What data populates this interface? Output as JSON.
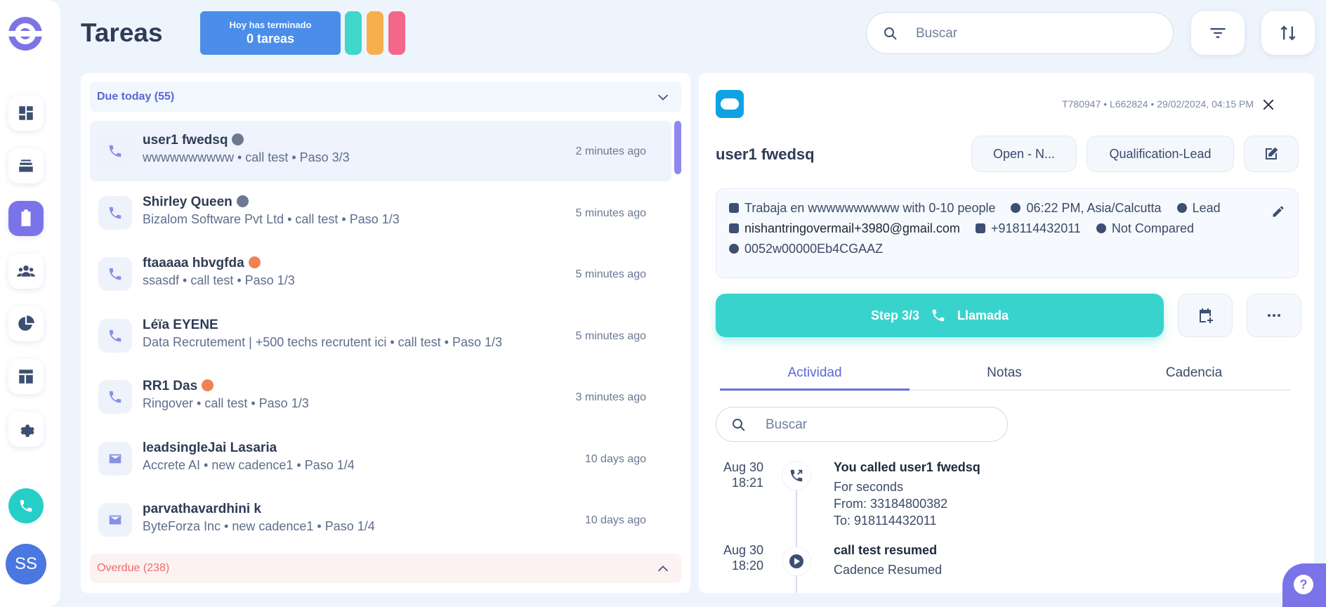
{
  "header": {
    "title": "Tareas",
    "done_line1": "Hoy has terminado",
    "done_line2": "0 tareas",
    "search_placeholder": "Buscar",
    "pills": [
      "#3ed7c9",
      "#f7ae4c",
      "#f4678a"
    ]
  },
  "sidebar": {
    "items": [
      "dashboard-icon",
      "inbox-icon",
      "tasks-icon",
      "contacts-icon",
      "reports-icon",
      "templates-icon",
      "settings-icon"
    ],
    "active": "tasks-icon",
    "avatar": "SS"
  },
  "list": {
    "due_label": "Due today (55)",
    "overdue_label": "Overdue (238)",
    "tasks": [
      {
        "type": "call",
        "name": "user1 fwedsq",
        "globe": "grey",
        "sub": "wwwwwwwwww • call test • Paso 3/3",
        "time": "2 minutes ago",
        "active": true
      },
      {
        "type": "call",
        "name": "Shirley Queen",
        "globe": "grey",
        "sub": "Bizalom Software Pvt Ltd • call test • Paso 1/3",
        "time": "5 minutes ago"
      },
      {
        "type": "call",
        "name": "ftaaaaa hbvgfda",
        "globe": "orange",
        "sub": "ssasdf • call test • Paso 1/3",
        "time": "5 minutes ago"
      },
      {
        "type": "call",
        "name": "Léïa EYENE",
        "globe": "",
        "sub": "Data Recrutement | +500 techs recrutent ici • call test • Paso 1/3",
        "time": "5 minutes ago"
      },
      {
        "type": "call",
        "name": "RR1 Das",
        "globe": "orange",
        "sub": "Ringover • call test • Paso 1/3",
        "time": "3 minutes ago"
      },
      {
        "type": "email",
        "name": "leadsingleJai Lasaria",
        "globe": "",
        "sub": "Accrete AI • new cadence1 • Paso 1/4",
        "time": "10 days ago"
      },
      {
        "type": "email",
        "name": "parvathavardhini k",
        "globe": "",
        "sub": "ByteForza Inc • new cadence1 • Paso 1/4",
        "time": "10 days ago"
      }
    ]
  },
  "detail": {
    "meta": "T780947 • L662824 • 29/02/2024, 04:15 PM",
    "lead_name": "user1 fwedsq",
    "status_chip": "Open - N...",
    "stage_chip": "Qualification-Lead",
    "info": {
      "company": "Trabaja en wwwwwwwwww with 0-10 people",
      "timezone": "06:22 PM, Asia/Calcutta",
      "type": "Lead",
      "email": "nishantringovermail+3980@gmail.com",
      "phone": "+918114432011",
      "compare": "Not Compared",
      "sf_id": "0052w00000Eb4CGAAZ"
    },
    "step_label": "Step 3/3",
    "step_action": "Llamada",
    "tabs": [
      "Actividad",
      "Notas",
      "Cadencia"
    ],
    "active_tab": "Actividad",
    "search_placeholder": "Buscar",
    "activities": [
      {
        "date": "Aug 30",
        "time": "18:21",
        "icon": "call-outgoing-icon",
        "title": "You called user1 fwedsq",
        "lines": [
          "For seconds",
          "From: 33184800382",
          "To: 918114432011"
        ]
      },
      {
        "date": "Aug 30",
        "time": "18:20",
        "icon": "resume-icon",
        "title": "call test resumed",
        "lines": [
          "Cadence Resumed"
        ]
      }
    ]
  },
  "colors": {
    "accent": "#7b74e8",
    "teal": "#39d3ce",
    "due": "#5967d6",
    "overdue": "#ef6b6b"
  }
}
